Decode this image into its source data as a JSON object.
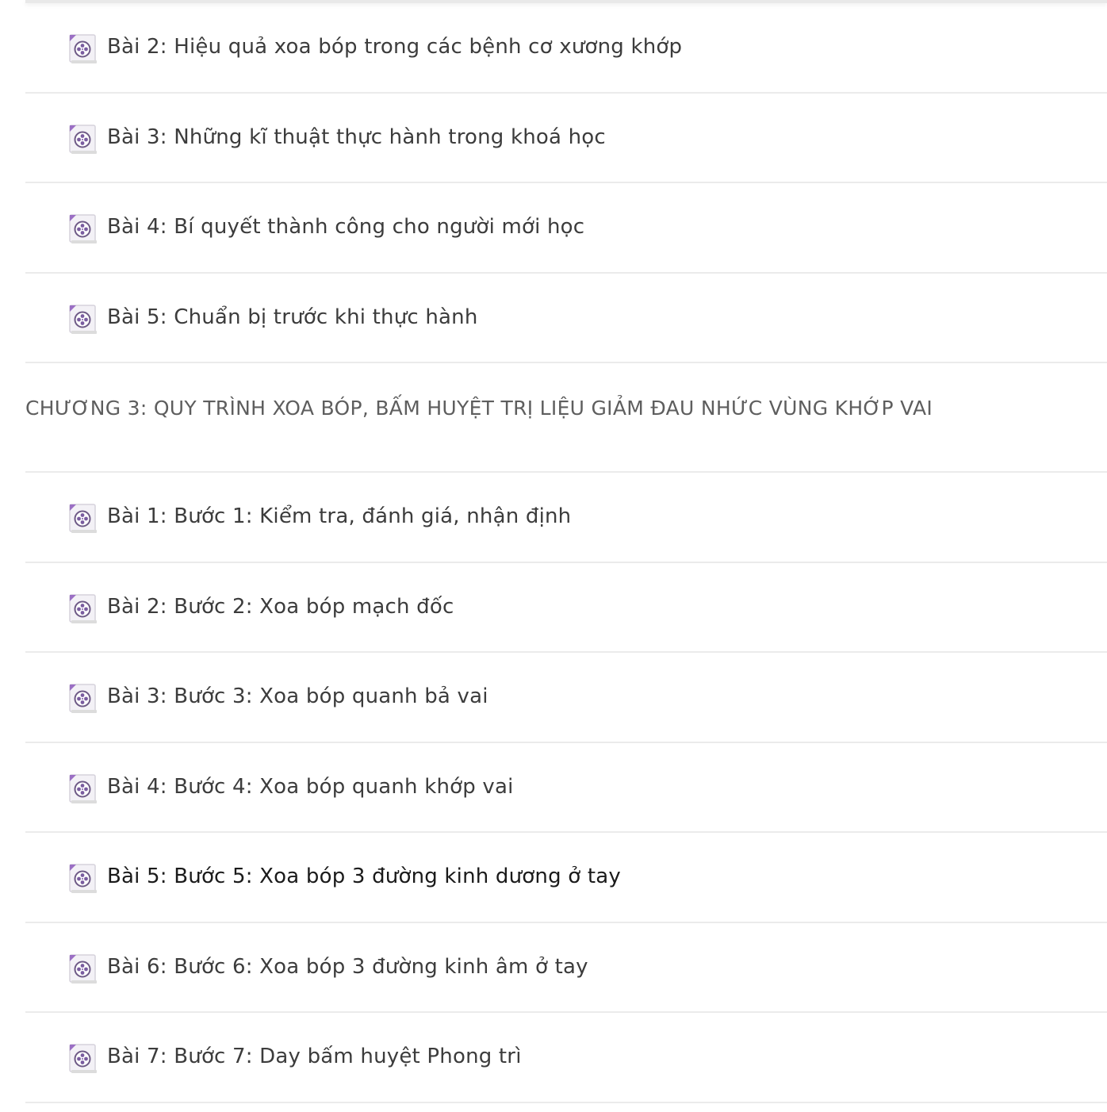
{
  "icons": {
    "lesson_icon": "video-file-icon",
    "accent": "#8a5fb5"
  },
  "sections": [
    {
      "kind": "lessons",
      "items": [
        {
          "label": "Bài 2: Hiệu quả xoa bóp trong các bệnh cơ xương khớp"
        },
        {
          "label": "Bài 3: Những kĩ thuật thực hành trong khoá học"
        },
        {
          "label": "Bài 4: Bí quyết thành công cho người mới học"
        },
        {
          "label": "Bài 5: Chuẩn bị trước khi thực hành"
        }
      ]
    },
    {
      "kind": "chapter",
      "title": "CHƯƠNG 3: QUY TRÌNH XOA BÓP, BẤM HUYỆT TRỊ LIỆU GIẢM ĐAU NHỨC VÙNG KHỚP VAI",
      "items": [
        {
          "label": "Bài 1: Bước 1: Kiểm tra, đánh giá, nhận định"
        },
        {
          "label": "Bài 2: Bước 2: Xoa bóp mạch đốc"
        },
        {
          "label": "Bài 3: Bước 3: Xoa bóp quanh bả vai"
        },
        {
          "label": "Bài 4: Bước 4: Xoa bóp quanh khớp vai"
        },
        {
          "label": "Bài 5: Bước 5: Xoa bóp 3 đường kinh dương ở tay"
        },
        {
          "label": "Bài 6: Bước 6: Xoa bóp 3 đường kinh âm ở tay"
        },
        {
          "label": "Bài 7: Bước 7: Day bấm huyệt Phong trì"
        }
      ]
    }
  ]
}
